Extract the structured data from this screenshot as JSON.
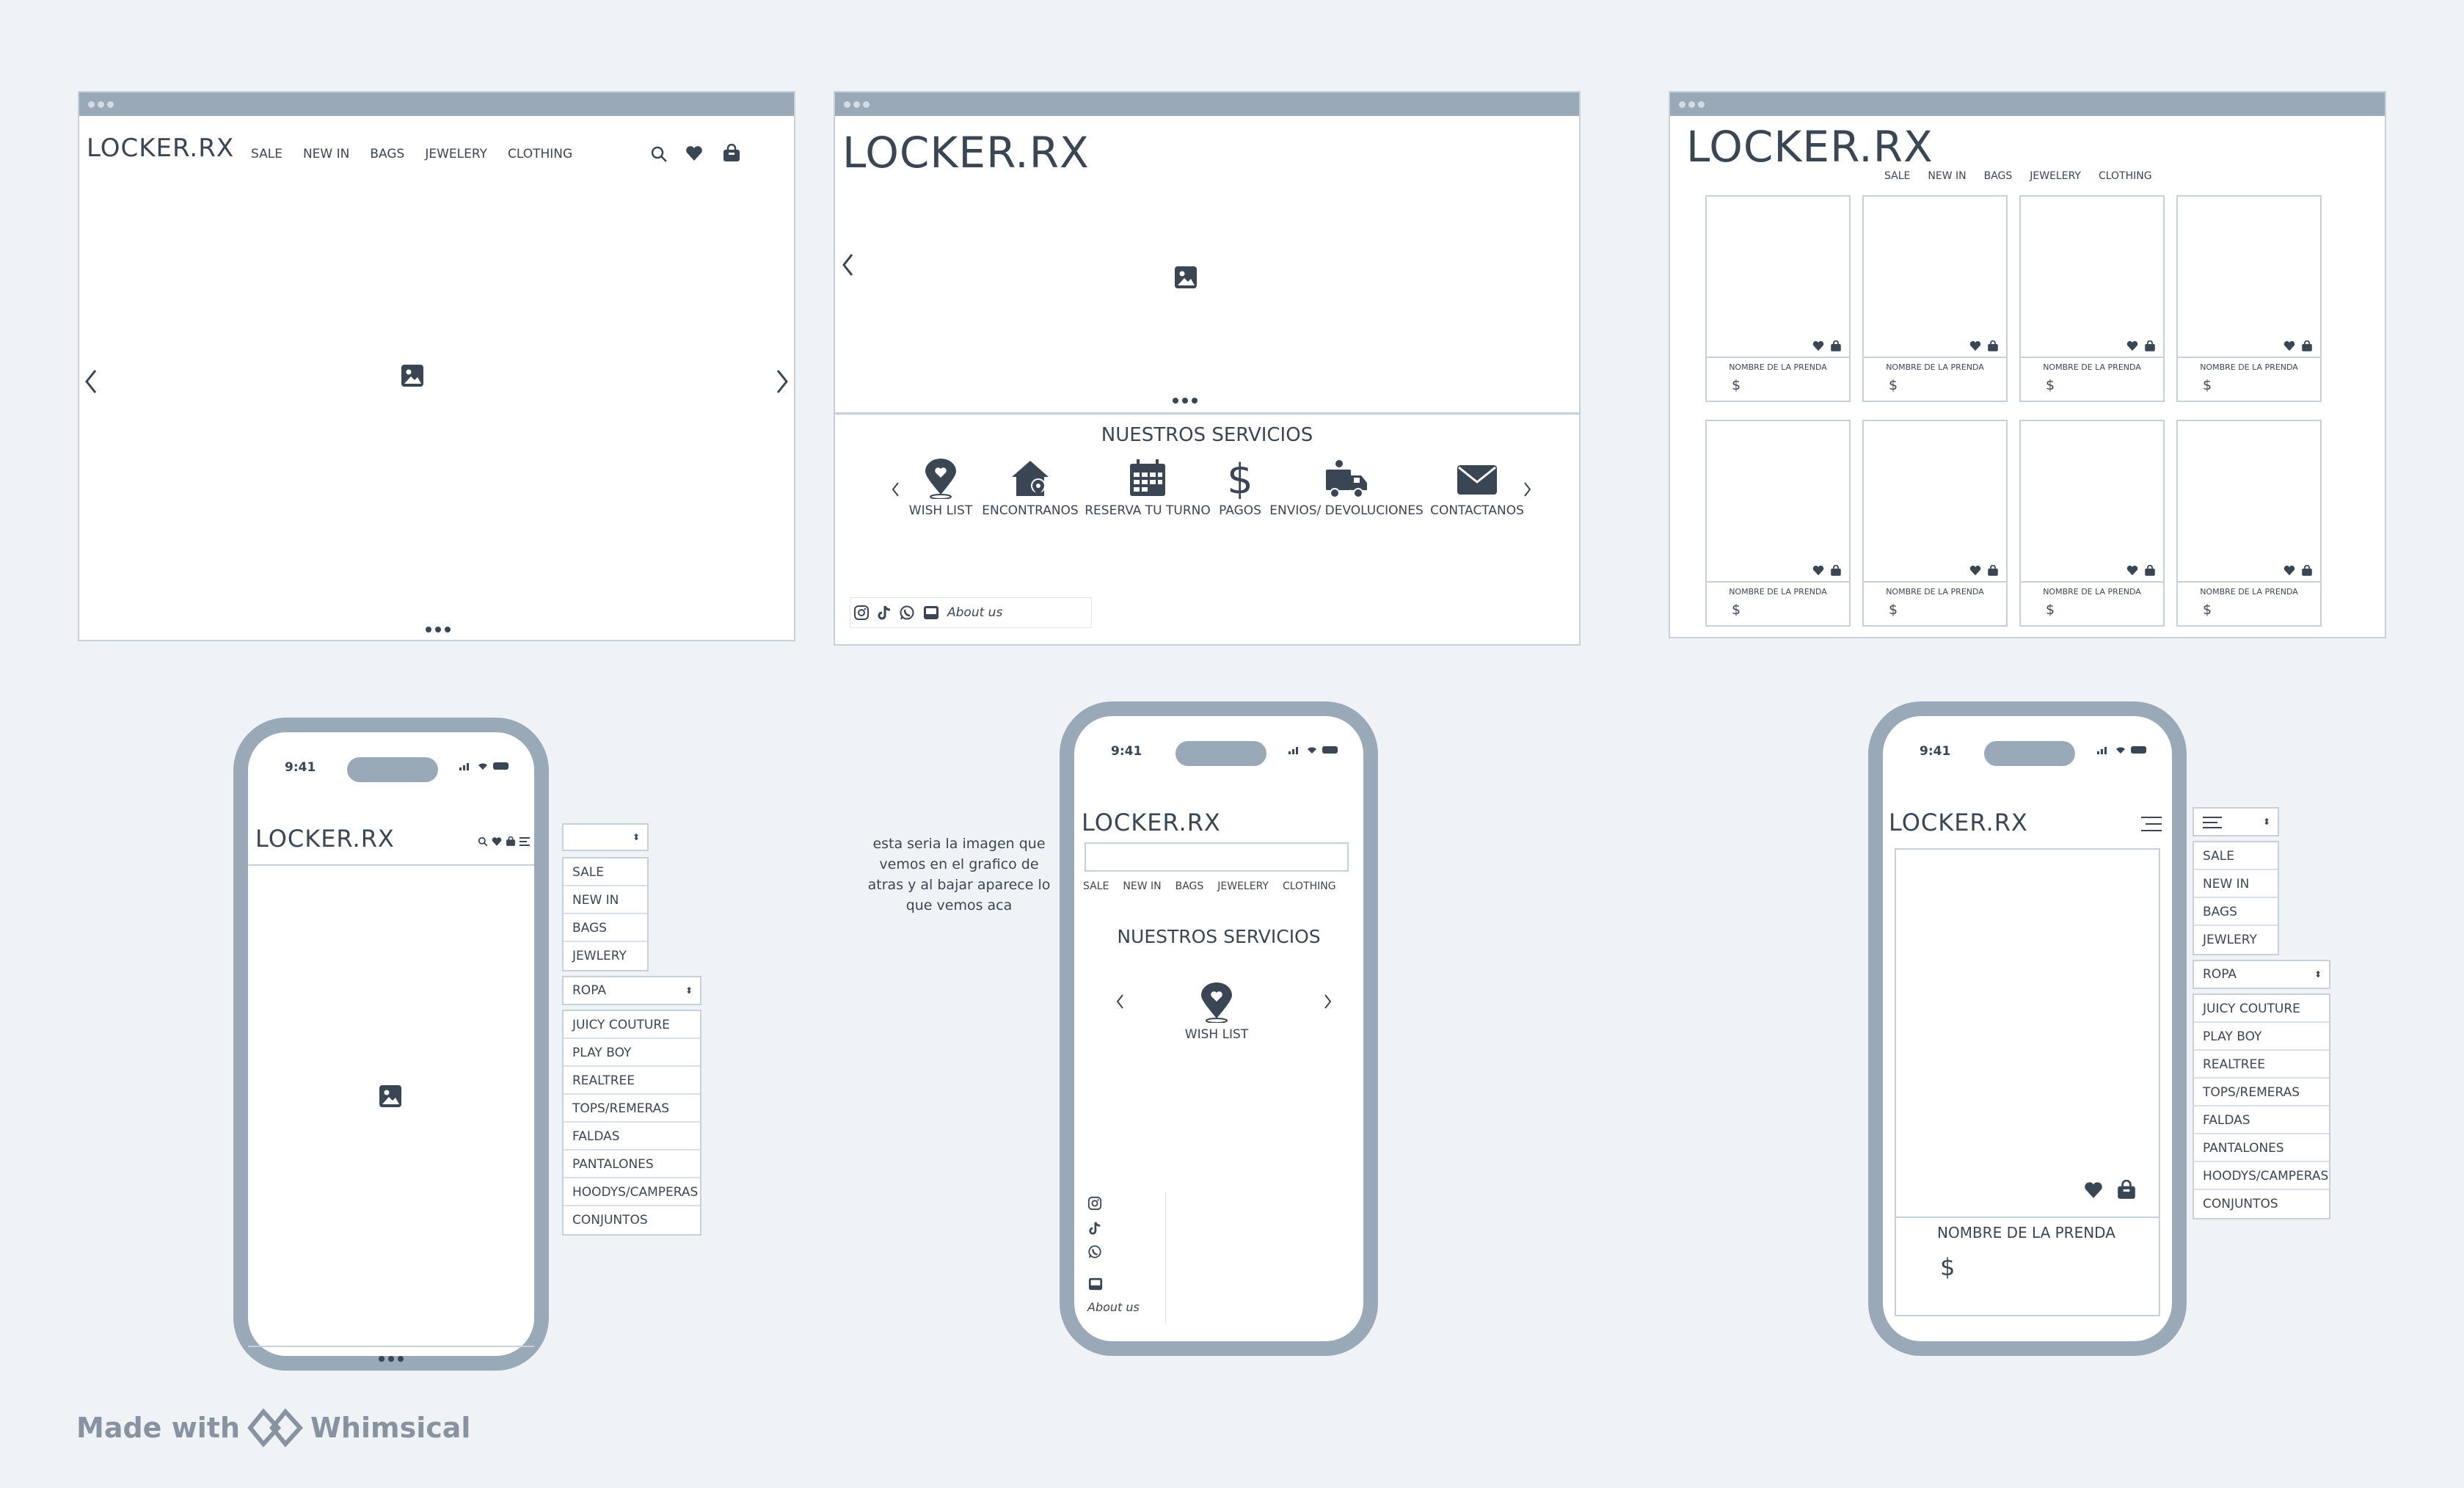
{
  "brand": "LOCKER.RX",
  "nav": [
    "SALE",
    "NEW IN",
    "BAGS",
    "JEWELERY",
    "CLOTHING"
  ],
  "screen2": {
    "services_title": "NUESTROS SERVICIOS",
    "services": [
      {
        "icon": "map-heart-pin-icon",
        "label": "WISH LIST"
      },
      {
        "icon": "house-pin-icon",
        "label": "ENCONTRANOS"
      },
      {
        "icon": "calendar-icon",
        "label": "RESERVA TU TURNO"
      },
      {
        "icon": "dollar-icon",
        "label": "PAGOS"
      },
      {
        "icon": "delivery-truck-icon",
        "label": "ENVIOS/ DEVOLUCIONES"
      },
      {
        "icon": "envelope-icon",
        "label": "CONTACTANOS"
      }
    ],
    "about": "About us"
  },
  "product": {
    "name": "NOMBRE DE LA PRENDA",
    "price": "$"
  },
  "mobile": {
    "time": "9:41",
    "menu_items": [
      "SALE",
      "NEW IN",
      "BAGS",
      "JEWLERY"
    ],
    "menu_items_m3": [
      "SALE",
      "NEW IN",
      "BAGS",
      "JEWLERY"
    ],
    "ropa_label": "ROPA",
    "ropa_items": [
      "JUICY COUTURE",
      "PLAY BOY",
      "REALTREE",
      "TOPS/REMERAS",
      "FALDAS",
      "PANTALONES",
      "HOODYS/CAMPERAS",
      "CONJUNTOS"
    ],
    "nav_m2": [
      "SALE",
      "NEW IN",
      "BAGS",
      "JEWELERY",
      "CLOTHING"
    ],
    "service_label": "WISH LIST",
    "services_title": "NUESTROS SERVICIOS",
    "about": "About us",
    "note": "esta seria la imagen que vemos en el grafico de atras y al bajar aparece lo que vemos aca"
  },
  "footer": {
    "made_with": "Made with",
    "brand": "Whimsical"
  }
}
